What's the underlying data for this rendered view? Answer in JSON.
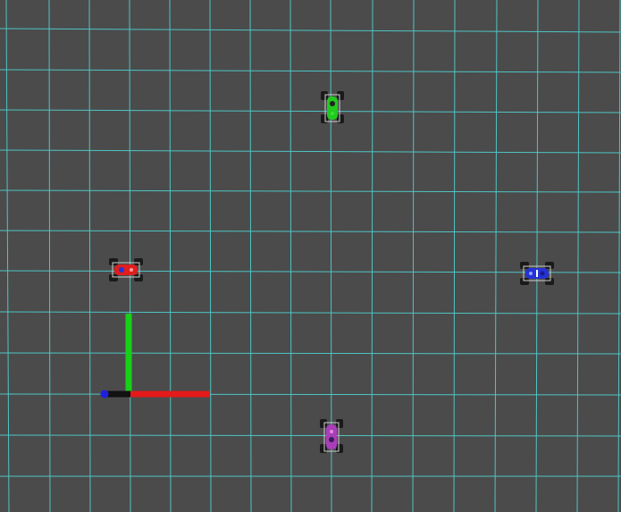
{
  "scene": {
    "background_color": "#4b4b4b",
    "grid_color": "#4fc4c4",
    "grid_visible": true
  },
  "axes": {
    "x_axis_color": "#e41a1a",
    "y_axis_color": "#19d019",
    "z_axis_color": "#1f1fe0"
  },
  "vehicles": [
    {
      "id": "green",
      "body_color": "#22c91e",
      "heading": "up"
    },
    {
      "id": "red",
      "body_color": "#e01e1e",
      "heading": "right"
    },
    {
      "id": "blue",
      "body_color": "#2432d6",
      "heading": "left"
    },
    {
      "id": "purple",
      "body_color": "#a83fb8",
      "heading": "down"
    }
  ]
}
